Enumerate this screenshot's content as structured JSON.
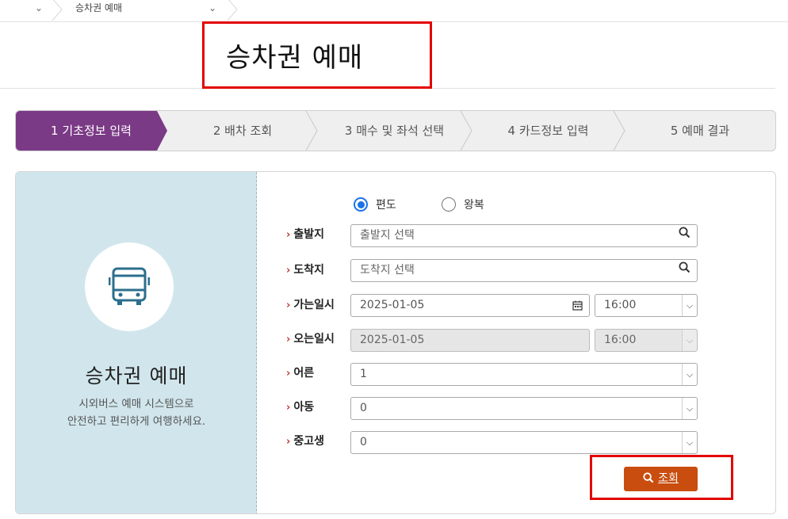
{
  "breadcrumb": {
    "current": "승차권 예매"
  },
  "page": {
    "title": "승차권 예매"
  },
  "steps": [
    {
      "label": "1 기초정보 입력",
      "active": true
    },
    {
      "label": "2 배차 조회",
      "active": false
    },
    {
      "label": "3 매수 및 좌석 선택",
      "active": false
    },
    {
      "label": "4 카드정보 입력",
      "active": false
    },
    {
      "label": "5 예매 결과",
      "active": false
    }
  ],
  "colors": {
    "active_step": "#7b3a86",
    "panel": "#d1e6ec",
    "button": "#c84d0e",
    "highlight": "#e30000",
    "bus_icon": "#2b6f8c"
  },
  "panel": {
    "icon": "bus-icon",
    "title": "승차권 예매",
    "desc_line1": "시외버스 예매 시스템으로",
    "desc_line2": "안전하고 편리하게 여행하세요."
  },
  "trip_type": {
    "one_way": "편도",
    "round_trip": "왕복",
    "selected": "one_way"
  },
  "form": {
    "departure_label": "출발지",
    "departure_placeholder": "출발지 선택",
    "arrival_label": "도착지",
    "arrival_placeholder": "도착지 선택",
    "go_label": "가는일시",
    "go_date": "2025-01-05",
    "go_time": "16:00",
    "return_label": "오는일시",
    "return_date": "2025-01-05",
    "return_time": "16:00",
    "adult_label": "어른",
    "adult_value": "1",
    "child_label": "아동",
    "child_value": "0",
    "student_label": "중고생",
    "student_value": "0"
  },
  "search_button": {
    "label": "조회",
    "icon": "search-icon"
  }
}
